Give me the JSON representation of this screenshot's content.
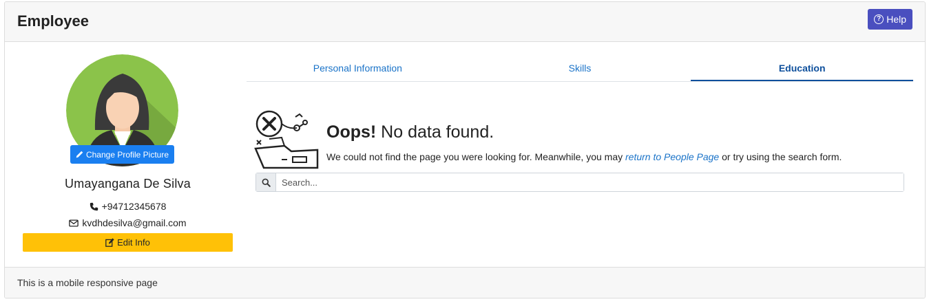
{
  "header": {
    "title": "Employee",
    "help_label": "Help"
  },
  "profile": {
    "change_picture_label": "Change Profile Picture",
    "name": "Umayangana De Silva",
    "phone": "+94712345678",
    "email": "kvdhdesilva@gmail.com",
    "edit_label": "Edit Info"
  },
  "tabs": [
    {
      "label": "Personal Information",
      "active": false
    },
    {
      "label": "Skills",
      "active": false
    },
    {
      "label": "Education",
      "active": true
    }
  ],
  "empty_state": {
    "title_bold": "Oops!",
    "title_rest": " No data found.",
    "message_before": "We could not find the page you were looking for. Meanwhile, you may ",
    "link_text": "return to People Page",
    "message_after": " or try using the search form."
  },
  "search": {
    "placeholder": "Search..."
  },
  "footer": {
    "text": "This is a mobile responsive page"
  },
  "colors": {
    "help_button": "#4a4fbf",
    "change_picture_button": "#1a7ff0",
    "edit_button": "#ffc107",
    "active_tab": "#0d4f9c",
    "link": "#1a73c8",
    "avatar_bg": "#8bc34a"
  },
  "icons": [
    "question-circle-icon",
    "pencil-icon",
    "phone-icon",
    "envelope-icon",
    "edit-icon",
    "search-icon",
    "no-data-illustration"
  ]
}
